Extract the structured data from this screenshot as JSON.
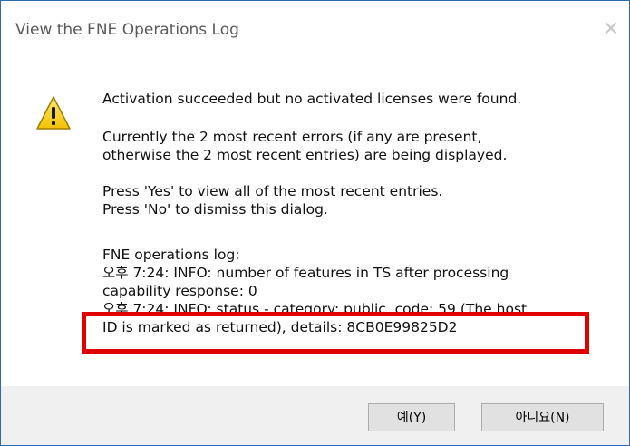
{
  "window": {
    "title": "View the FNE Operations Log",
    "close_symbol": "✕"
  },
  "message": {
    "line1": "Activation succeeded but no activated licenses were found.",
    "para2_line1": "Currently the 2 most recent errors (if any are present,",
    "para2_line2": "otherwise the 2 most recent entries) are being displayed.",
    "para3_line1": "Press 'Yes' to view all of the most recent entries.",
    "para3_line2": "Press 'No' to dismiss this dialog.",
    "log_header": "FNE operations log:",
    "log_entry1_line1": "오후 7:24: INFO: number of features in TS after processing",
    "log_entry1_line2": "capability response: 0",
    "log_entry2_line1": "오후 7:24: INFO: status - category: public, code: 59 (The host",
    "log_entry2_line2": "ID is marked as returned), details: 8CB0E99825D2"
  },
  "icon": "warning-icon",
  "buttons": {
    "yes_label": "예(Y)",
    "no_label": "아니요(N)"
  },
  "colors": {
    "highlight_border": "#e00000",
    "footer_bg": "#f0f0f0",
    "button_bg": "#e1e1e1",
    "window_border": "#2b6cb0"
  }
}
